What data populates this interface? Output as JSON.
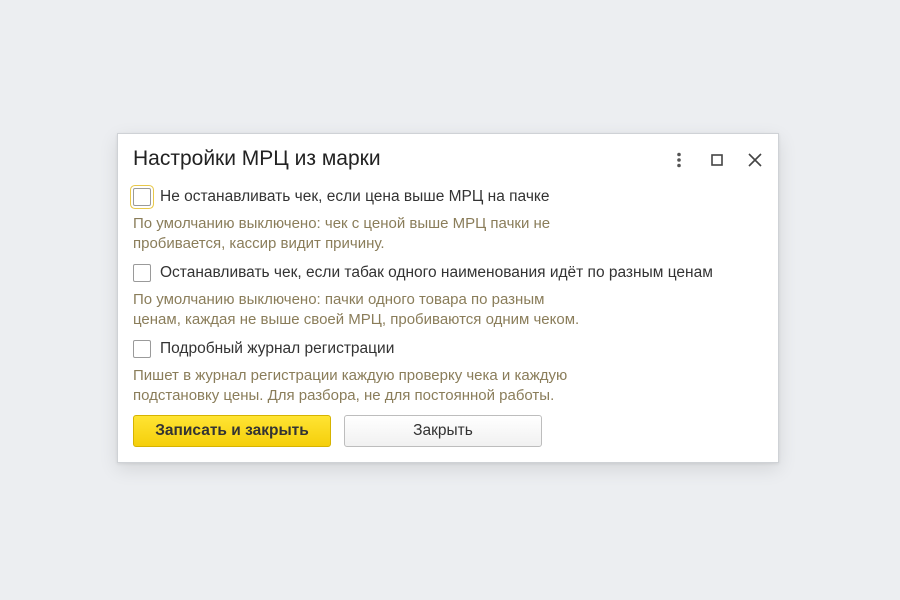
{
  "dialog": {
    "title": "Настройки МРЦ из марки",
    "controls": {
      "more_icon": "vertical-dots-icon",
      "maximize_icon": "maximize-icon",
      "close_icon": "close-icon"
    }
  },
  "options": [
    {
      "label": "Не останавливать чек, если цена выше МРЦ на пачке",
      "checked": false,
      "hint_line1": "По умолчанию выключено: чек с ценой выше МРЦ пачки не",
      "hint_line2": "пробивается, кассир видит причину."
    },
    {
      "label": "Останавливать чек, если табак одного наименования идёт по разным ценам",
      "checked": false,
      "hint_line1": "По умолчанию выключено: пачки одного товара по разным",
      "hint_line2": "ценам, каждая не выше своей МРЦ, пробиваются одним чеком."
    },
    {
      "label": "Подробный журнал регистрации",
      "checked": false,
      "hint_line1": "Пишет в журнал регистрации каждую проверку чека и каждую",
      "hint_line2": "подстановку цены. Для разбора, не для постоянной работы."
    }
  ],
  "buttons": {
    "save_close": "Записать и закрыть",
    "close": "Закрыть"
  },
  "colors": {
    "primary_button": "#f5cf0b",
    "hint_text": "#8a7d5a",
    "background": "#eceef1"
  }
}
